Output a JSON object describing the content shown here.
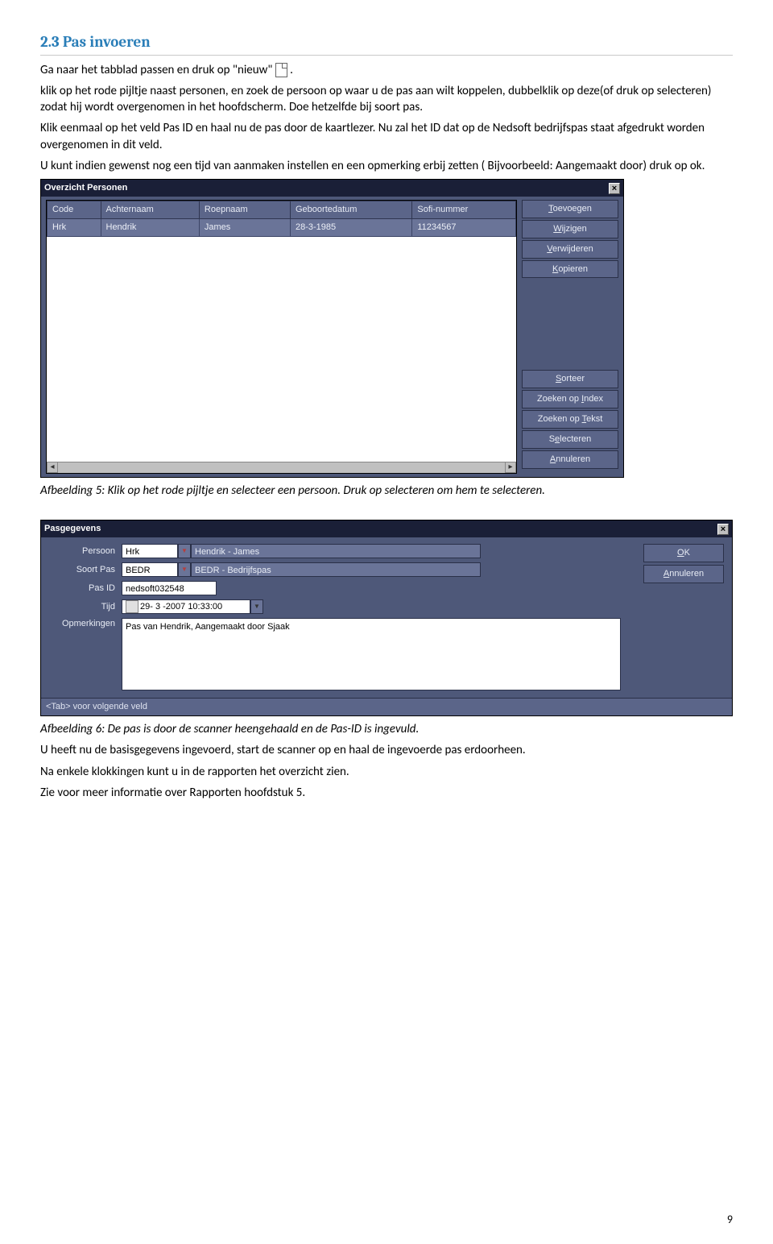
{
  "heading": "2.3   Pas invoeren",
  "intro": {
    "line1a": "Ga naar het tabblad passen en druk op \"nieuw\" ",
    "line1b": ".",
    "line2": "klik op het rode pijltje naast personen, en zoek de persoon op waar u de pas aan wilt koppelen, dubbelklik op deze(of druk op selecteren) zodat hij wordt overgenomen in het hoofdscherm. Doe hetzelfde bij soort pas.",
    "line3": "Klik eenmaal op het veld Pas ID en haal nu de pas door de kaartlezer. Nu zal het ID dat op de Nedsoft bedrijfspas staat afgedrukt worden overgenomen in dit veld.",
    "line4": "U kunt indien gewenst nog een tijd van aanmaken instellen en een opmerking erbij zetten ( Bijvoorbeeld: Aangemaakt door) druk op ok."
  },
  "dialog1": {
    "title": "Overzicht Personen",
    "headers": [
      "Code",
      "Achternaam",
      "Roepnaam",
      "Geboortedatum",
      "Sofi-nummer"
    ],
    "row": [
      "Hrk",
      "Hendrik",
      "James",
      "28-3-1985",
      "11234567"
    ],
    "buttons_top": [
      "Toevoegen",
      "Wijzigen",
      "Verwijderen",
      "Kopieren"
    ],
    "buttons_bot": [
      "Sorteer",
      "Zoeken op Index",
      "Zoeken op Tekst",
      "Selecteren",
      "Annuleren"
    ]
  },
  "caption5": "Afbeelding 5: Klik op het rode pijltje en selecteer een persoon. Druk op selecteren om hem te selecteren.",
  "dialog2": {
    "title": "Pasgegevens",
    "labels": {
      "persoon": "Persoon",
      "soortpas": "Soort Pas",
      "pasid": "Pas ID",
      "tijd": "Tijd",
      "opmerkingen": "Opmerkingen"
    },
    "values": {
      "persoon_code": "Hrk",
      "persoon_name": "Hendrik  - James",
      "soortpas_code": "BEDR",
      "soortpas_name": "BEDR - Bedrijfspas",
      "pasid": "nedsoft032548",
      "tijd": "29- 3 -2007 10:33:00",
      "opmerkingen": "Pas van Hendrik, Aangemaakt door Sjaak"
    },
    "buttons": {
      "ok": "OK",
      "annul": "Annuleren"
    },
    "status": "<Tab>  voor volgende veld"
  },
  "caption6": "Afbeelding 6: De pas is door de scanner heengehaald en de Pas-ID is ingevuld.",
  "outro": {
    "l1": "U heeft nu de basisgegevens ingevoerd, start de scanner op en haal de ingevoerde pas erdoorheen.",
    "l2": "Na enkele klokkingen kunt u in de rapporten het overzicht zien.",
    "l3": " Zie voor meer informatie over Rapporten hoofdstuk 5."
  },
  "page": "9"
}
